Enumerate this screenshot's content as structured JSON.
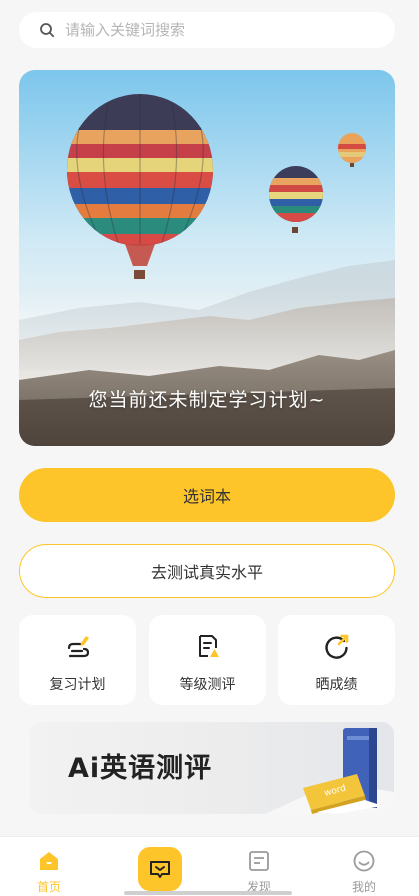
{
  "search": {
    "placeholder": "请输入关键词搜索"
  },
  "banner": {
    "text": "您当前还未制定学习计划~"
  },
  "actions": {
    "primary_label": "选词本",
    "secondary_label": "去测试真实水平"
  },
  "cards": [
    {
      "label": "复习计划",
      "icon": "review-plan-icon"
    },
    {
      "label": "等级测评",
      "icon": "level-test-icon"
    },
    {
      "label": "晒成绩",
      "icon": "share-score-icon"
    }
  ],
  "promo": {
    "ai": "Ai",
    "title": "英语测评",
    "book_tag": "word"
  },
  "tabbar": {
    "items": [
      {
        "label": "首页",
        "icon": "home-icon",
        "active": true
      },
      {
        "label": "",
        "icon": "chat-icon",
        "active": false
      },
      {
        "label": "发现",
        "icon": "discover-icon",
        "active": false
      },
      {
        "label": "我的",
        "icon": "profile-icon",
        "active": false
      }
    ]
  },
  "colors": {
    "accent": "#fec52a",
    "background": "#f6f6f6"
  }
}
